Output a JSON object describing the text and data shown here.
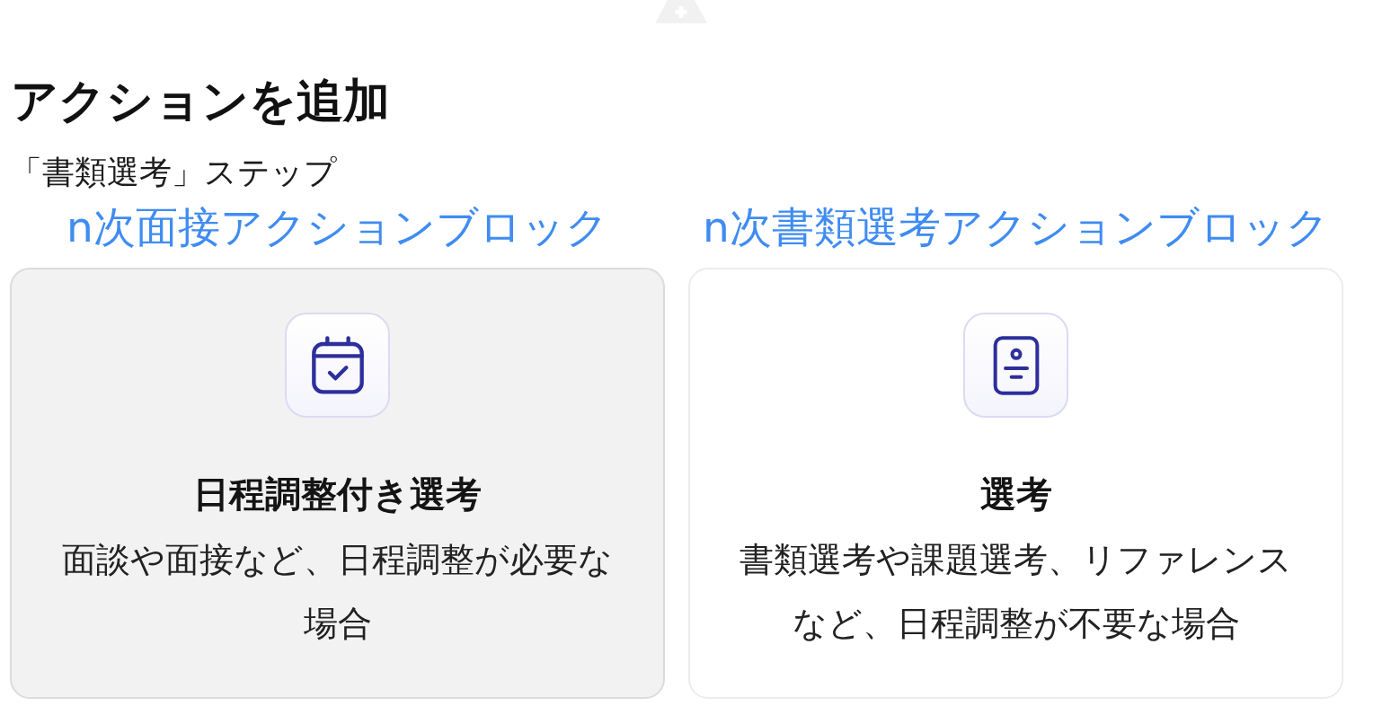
{
  "title": "アクションを追加",
  "subtitle": "「書類選考」ステップ",
  "cards": [
    {
      "kind": "interview",
      "annotation": "n次面接アクションブロック",
      "title": "日程調整付き選考",
      "description": "面談や面接など、日程調整が必要な場合",
      "selected": true
    },
    {
      "kind": "screening",
      "annotation": "n次書類選考アクションブロック",
      "title": "選考",
      "description": "書類選考や課題選考、リファレンスなど、日程調整が不要な場合",
      "selected": false
    }
  ]
}
